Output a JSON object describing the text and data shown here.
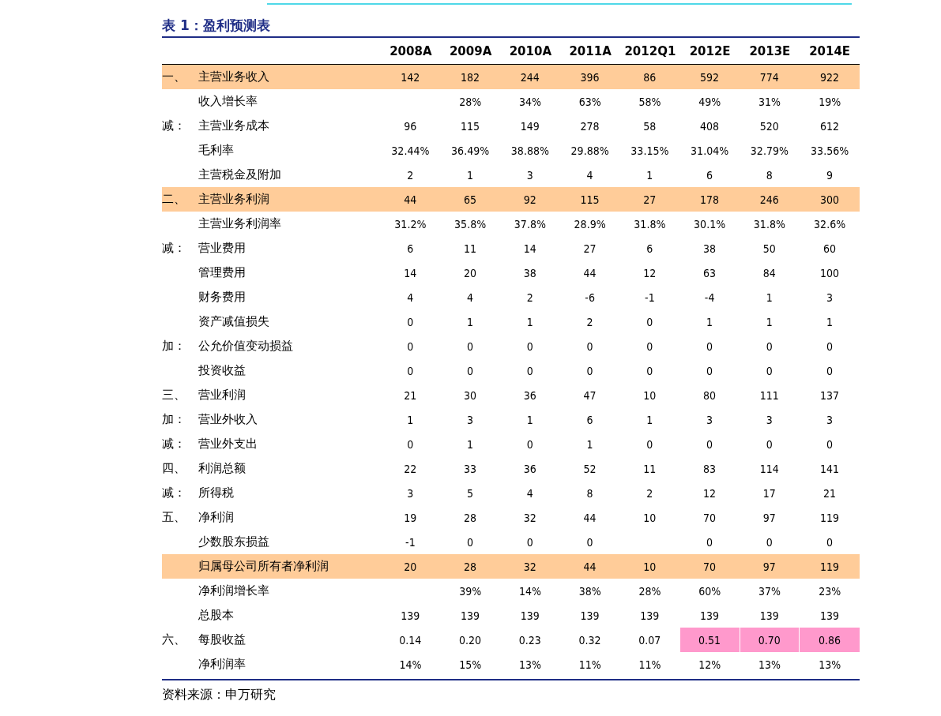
{
  "title": "表 1：盈利预测表",
  "columns": [
    "2008A",
    "2009A",
    "2010A",
    "2011A",
    "2012Q1",
    "2012E",
    "2013E",
    "2014E"
  ],
  "rows": [
    {
      "prefix": "一、",
      "label": "主营业务收入",
      "highlighted": true,
      "cells": [
        "142",
        "182",
        "244",
        "396",
        "86",
        "592",
        "774",
        "922"
      ]
    },
    {
      "label": "收入增长率",
      "highlighted": false,
      "cells": [
        null,
        "28%",
        "34%",
        "63%",
        "58%",
        "49%",
        "31%",
        "19%"
      ]
    },
    {
      "prefix": "减：",
      "label": "主营业务成本",
      "highlighted": false,
      "cells": [
        "96",
        "115",
        "149",
        "278",
        "58",
        "408",
        "520",
        "612"
      ]
    },
    {
      "label": "毛利率",
      "highlighted": false,
      "cells": [
        "32.44%",
        "36.49%",
        "38.88%",
        "29.88%",
        "33.15%",
        "31.04%",
        "32.79%",
        "33.56%"
      ]
    },
    {
      "label": "主营税金及附加",
      "highlighted": false,
      "cells": [
        "2",
        "1",
        "3",
        "4",
        "1",
        "6",
        "8",
        "9"
      ]
    },
    {
      "prefix": "二、",
      "label": "主营业务利润",
      "highlighted": true,
      "cells": [
        "44",
        "65",
        "92",
        "115",
        "27",
        "178",
        "246",
        "300"
      ]
    },
    {
      "label": "主营业务利润率",
      "highlighted": false,
      "cells": [
        "31.2%",
        "35.8%",
        "37.8%",
        "28.9%",
        "31.8%",
        "30.1%",
        "31.8%",
        "32.6%"
      ]
    },
    {
      "prefix": "减：",
      "label": "营业费用",
      "highlighted": false,
      "cells": [
        "6",
        "11",
        "14",
        "27",
        "6",
        "38",
        "50",
        "60"
      ]
    },
    {
      "label": "管理费用",
      "highlighted": false,
      "cells": [
        "14",
        "20",
        "38",
        "44",
        "12",
        "63",
        "84",
        "100"
      ]
    },
    {
      "label": "财务费用",
      "highlighted": false,
      "cells": [
        "4",
        "4",
        "2",
        "-6",
        "-1",
        "-4",
        "1",
        "3"
      ]
    },
    {
      "label": "资产减值损失",
      "highlighted": false,
      "cells": [
        "0",
        "1",
        "1",
        "2",
        "0",
        "1",
        "1",
        "1"
      ]
    },
    {
      "prefix": "加：",
      "label": "公允价值变动损益",
      "highlighted": false,
      "cells": [
        "0",
        "0",
        "0",
        "0",
        "0",
        "0",
        "0",
        "0"
      ]
    },
    {
      "label": "投资收益",
      "highlighted": false,
      "cells": [
        "0",
        "0",
        "0",
        "0",
        "0",
        "0",
        "0",
        "0"
      ]
    },
    {
      "prefix": "三、",
      "label": "营业利润",
      "highlighted": false,
      "cells": [
        "21",
        "30",
        "36",
        "47",
        "10",
        "80",
        "111",
        "137"
      ]
    },
    {
      "prefix": "加：",
      "label": "营业外收入",
      "highlighted": false,
      "cells": [
        "1",
        "3",
        "1",
        "6",
        "1",
        "3",
        "3",
        "3"
      ]
    },
    {
      "prefix": "减：",
      "label": "营业外支出",
      "highlighted": false,
      "cells": [
        "0",
        "1",
        "0",
        "1",
        "0",
        "0",
        "0",
        "0"
      ]
    },
    {
      "prefix": "四、",
      "label": "利润总额",
      "highlighted": false,
      "cells": [
        "22",
        "33",
        "36",
        "52",
        "11",
        "83",
        "114",
        "141"
      ]
    },
    {
      "prefix": "减：",
      "label": "所得税",
      "highlighted": false,
      "cells": [
        "3",
        "5",
        "4",
        "8",
        "2",
        "12",
        "17",
        "21"
      ]
    },
    {
      "prefix": "五、",
      "label": "净利润",
      "highlighted": false,
      "cells": [
        "19",
        "28",
        "32",
        "44",
        "10",
        "70",
        "97",
        "119"
      ]
    },
    {
      "label": "少数股东损益",
      "highlighted": false,
      "cells": [
        "-1",
        "0",
        "0",
        "0",
        null,
        "0",
        "0",
        "0"
      ]
    },
    {
      "label": "归属母公司所有者净利润",
      "highlighted": true,
      "cells": [
        "20",
        "28",
        "32",
        "44",
        "10",
        "70",
        "97",
        "119"
      ]
    },
    {
      "label": "净利润增长率",
      "highlighted": false,
      "cells": [
        null,
        "39%",
        "14%",
        "38%",
        "28%",
        "60%",
        "37%",
        "23%"
      ]
    },
    {
      "label": "总股本",
      "highlighted": false,
      "cells": [
        "139",
        "139",
        "139",
        "139",
        "139",
        "139",
        "139",
        "139"
      ]
    },
    {
      "prefix": "六、",
      "label": "每股收益",
      "highlighted": false,
      "cells": [
        "0.14",
        "0.20",
        "0.23",
        "0.32",
        "0.07",
        "0.51",
        "0.70",
        "0.86"
      ],
      "cell_highlight": [
        false,
        false,
        false,
        false,
        false,
        true,
        true,
        true
      ]
    },
    {
      "label": "净利润率",
      "highlighted": false,
      "cells": [
        "14%",
        "15%",
        "13%",
        "11%",
        "11%",
        "12%",
        "13%",
        "13%"
      ]
    }
  ],
  "source": "资料来源：申万研究"
}
